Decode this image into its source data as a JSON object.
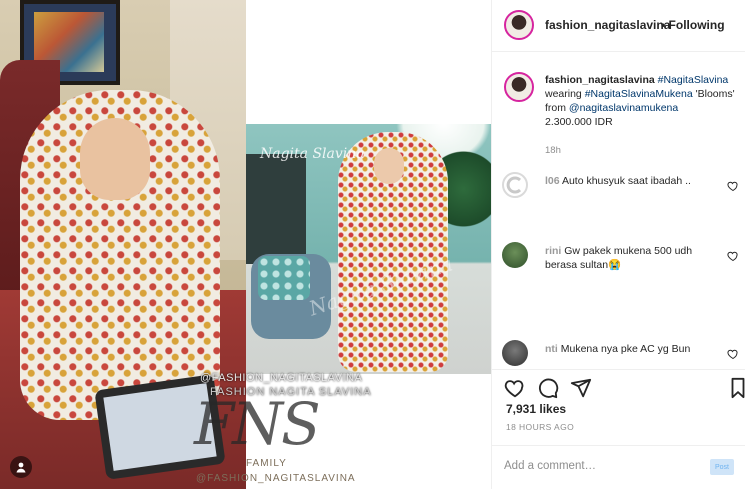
{
  "media": {
    "left_handle_overlay": "@FASHION_NAGITASLAVINA",
    "left_name_overlay": "FASHION NAGITA SLAVINA",
    "logo_overlay": "FNS",
    "family_overlay": "FAMILY",
    "footer_overlay": "@FASHION_NAGITASLAVINA",
    "right_script_watermark": "Nagita Slavina",
    "right_mid_watermark": "Nagita Slavina"
  },
  "header": {
    "username": "fashion_nagitaslavina",
    "follow_status": "• Following"
  },
  "caption": {
    "username": "fashion_nagitaslavina",
    "hashtag_1": "#NagitaSlavina",
    "text_1": "wearing",
    "hashtag_2": "#NagitaSlavinaMukena",
    "text_2": "'Blooms' from",
    "mention": "@nagitaslavinamukena",
    "price": "2.300.000 IDR",
    "time": "18h"
  },
  "comments": [
    {
      "username": "l06",
      "text": "Auto khusyuk saat ibadah .."
    },
    {
      "username": "rini",
      "text": "Gw pakek mukena 500 udh berasa sultan😭"
    },
    {
      "username": "nti",
      "text": "Mukena nya pke AC yg Bun"
    }
  ],
  "actions": {
    "likes": "7,931 likes",
    "time_ago": "18 HOURS AGO"
  },
  "add_comment": {
    "placeholder": "Add a comment…",
    "post_label": "Post"
  },
  "colors": {
    "accent_link": "#00376b",
    "story_ring": "#d6249f",
    "muted": "#8e8e8e"
  },
  "icons": [
    "heart-icon",
    "comment-icon",
    "share-icon",
    "bookmark-icon",
    "emoji-icon"
  ]
}
